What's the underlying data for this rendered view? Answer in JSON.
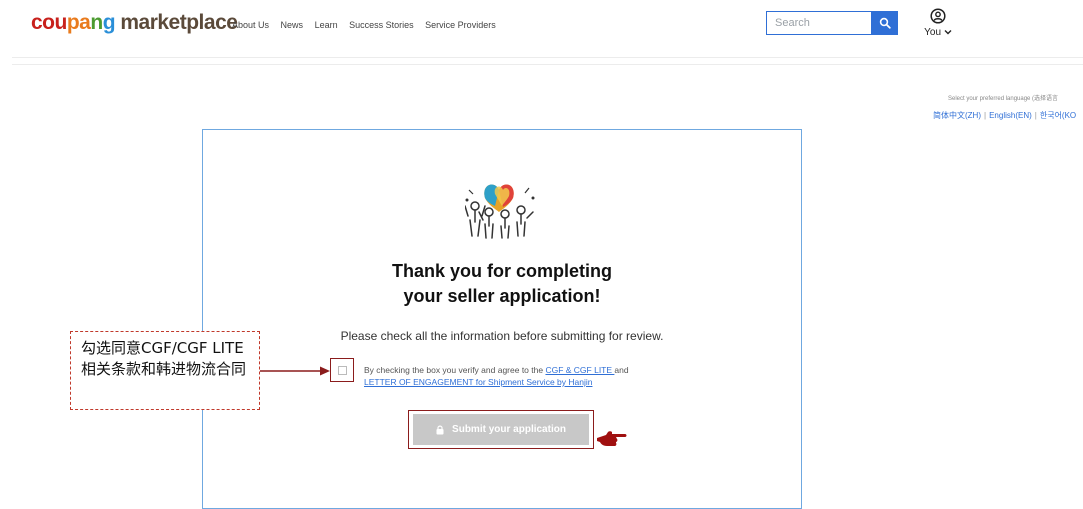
{
  "header": {
    "logo": {
      "c1": "cou",
      "c2": "pa",
      "c3": "n",
      "c4": "g",
      "c5": " marketplace"
    },
    "nav": [
      "About Us",
      "News",
      "Learn",
      "Success Stories",
      "Service Providers"
    ],
    "search": {
      "placeholder": "Search"
    },
    "user": {
      "label": "You"
    }
  },
  "language": {
    "hint": "Select your preferred language (选择语言",
    "options": [
      "简体中文(ZH)",
      "English(EN)",
      "한국어(KO"
    ]
  },
  "main": {
    "heading_line1": "Thank you for completing",
    "heading_line2": "your seller application!",
    "subtext": "Please check all the information before submitting for review.",
    "agree_prefix": "By checking the box you verify and agree to the ",
    "agree_link1": "CGF & CGF LITE ",
    "agree_mid": "and",
    "agree_link2": "LETTER OF ENGAGEMENT for Shipment Service by Hanjin",
    "submit_label": "Submit your application"
  },
  "annotation": {
    "note": "勾选同意CGF/CGF LITE相关条款和韩进物流合同"
  },
  "colors": {
    "accent": "#2f6fd6",
    "annotation": "#8b1c1c",
    "disabled_button": "#c8c8c8"
  }
}
